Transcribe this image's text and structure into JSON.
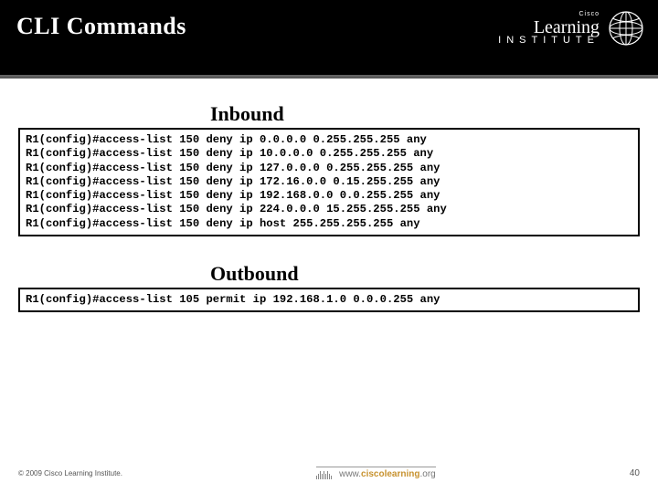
{
  "title": "CLI Commands",
  "logo": {
    "cisco": "Cisco",
    "brand": "Learning",
    "sub": "INSTITUTE"
  },
  "sections": {
    "inbound": {
      "heading": "Inbound",
      "lines": [
        "R1(config)#access-list 150 deny ip 0.0.0.0 0.255.255.255 any",
        "R1(config)#access-list 150 deny ip 10.0.0.0 0.255.255.255 any",
        "R1(config)#access-list 150 deny ip 127.0.0.0 0.255.255.255 any",
        "R1(config)#access-list 150 deny ip 172.16.0.0 0.15.255.255 any",
        "R1(config)#access-list 150 deny ip 192.168.0.0 0.0.255.255 any",
        "R1(config)#access-list 150 deny ip 224.0.0.0 15.255.255.255 any",
        "R1(config)#access-list 150 deny ip host 255.255.255.255 any"
      ]
    },
    "outbound": {
      "heading": "Outbound",
      "lines": [
        "R1(config)#access-list 105 permit ip 192.168.1.0 0.0.0.255 any"
      ]
    }
  },
  "footer": {
    "copyright": "© 2009 Cisco Learning Institute.",
    "url_w": "www.",
    "url_c": "ciscolearning",
    "url_o": ".org",
    "page": "40"
  }
}
